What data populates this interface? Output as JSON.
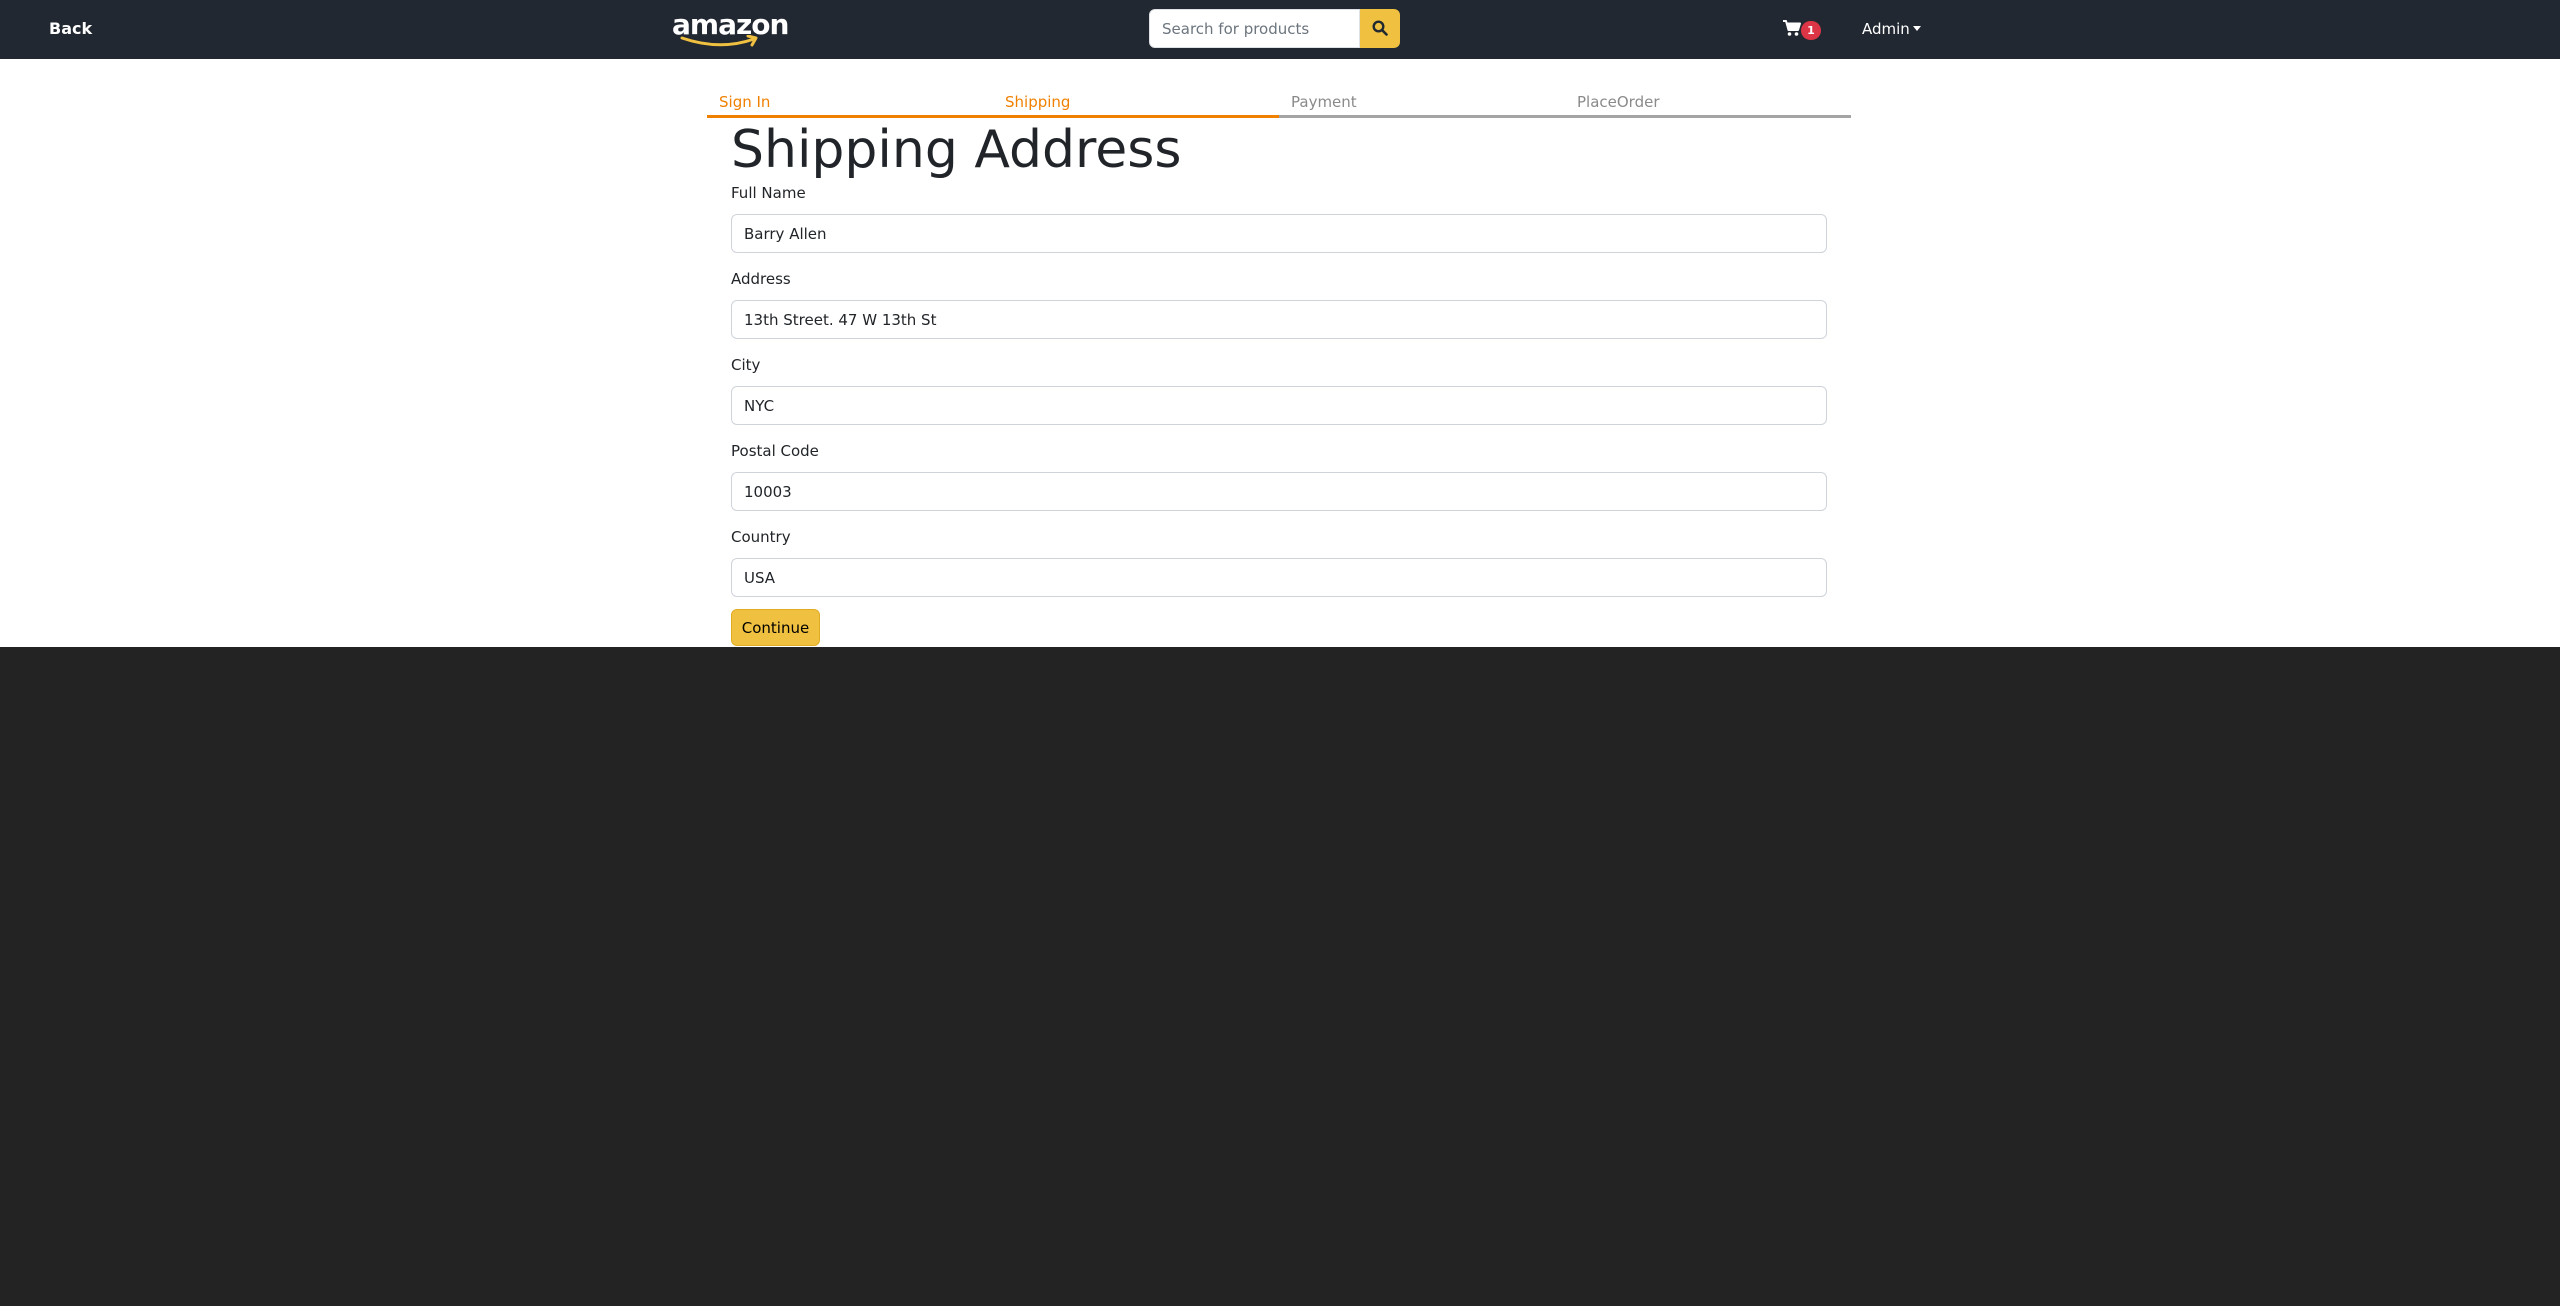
{
  "navbar": {
    "back_label": "Back",
    "logo_text": "amazon",
    "search": {
      "placeholder": "Search for products",
      "value": ""
    },
    "cart_count": "1",
    "user_menu_label": "Admin"
  },
  "checkout_steps": [
    {
      "label": "Sign In",
      "active": true
    },
    {
      "label": "Shipping",
      "active": true
    },
    {
      "label": "Payment",
      "active": false
    },
    {
      "label": "PlaceOrder",
      "active": false
    }
  ],
  "form": {
    "title": "Shipping Address",
    "fields": {
      "full_name": {
        "label": "Full Name",
        "value": "Barry Allen"
      },
      "address": {
        "label": "Address",
        "value": "13th Street. 47 W 13th St"
      },
      "city": {
        "label": "City",
        "value": "NYC"
      },
      "postal_code": {
        "label": "Postal Code",
        "value": "10003"
      },
      "country": {
        "label": "Country",
        "value": "USA"
      }
    },
    "submit_label": "Continue"
  },
  "colors": {
    "navbar_bg": "#222831",
    "accent": "#f0c040",
    "step_active": "#f08000",
    "step_inactive": "#a4a4a4",
    "badge": "#dc3545",
    "footer_bg": "#232323"
  },
  "icons": {
    "search": "search-icon",
    "cart": "cart-icon",
    "logo_smile": "amazon-smile-icon",
    "dropdown": "caret-down-icon"
  }
}
